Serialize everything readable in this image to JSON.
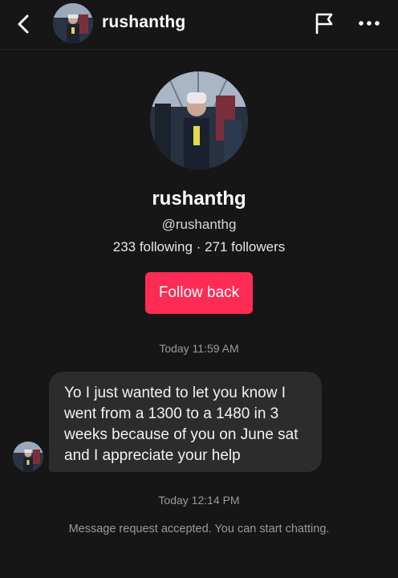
{
  "header": {
    "username": "rushanthg",
    "icons": {
      "back": "chevron-left-icon",
      "report": "flag-icon",
      "more": "more-horizontal-icon"
    }
  },
  "profile": {
    "name": "rushanthg",
    "handle": "@rushanthg",
    "stats": "233 following · 271 followers",
    "follow_button_label": "Follow back"
  },
  "conversation": {
    "timestamp_1": "Today 11:59 AM",
    "message_text": "Yo I just wanted to let you know I went from a 1300 to a 1480 in 3 weeks because of you on June sat and I appreciate your help",
    "timestamp_2": "Today 12:14 PM",
    "system_note": "Message request accepted. You can start chatting."
  },
  "colors": {
    "background": "#161616",
    "accent": "#fe2c55",
    "bubble": "#2c2c2c",
    "muted_text": "#9a9a9a"
  }
}
